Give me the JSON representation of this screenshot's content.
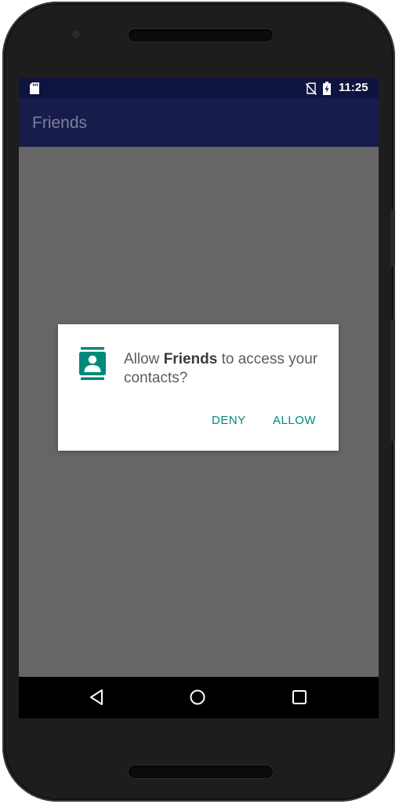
{
  "status_bar": {
    "time": "11:25",
    "icons": [
      "sd-card-icon",
      "no-sim-icon",
      "battery-charging-icon"
    ]
  },
  "app_bar": {
    "title": "Friends"
  },
  "permission_dialog": {
    "icon": "contacts-icon",
    "message_prefix": "Allow ",
    "app_name": "Friends",
    "message_suffix": " to access your contacts?",
    "deny_label": "DENY",
    "allow_label": "ALLOW",
    "accent_color": "#00897b"
  },
  "nav_bar": {
    "buttons": [
      "back-icon",
      "home-icon",
      "recents-icon"
    ]
  },
  "colors": {
    "status_bar": "#0f1340",
    "app_bar": "#171c4b",
    "scrim": "#666666",
    "dialog_accent": "#00897b"
  }
}
